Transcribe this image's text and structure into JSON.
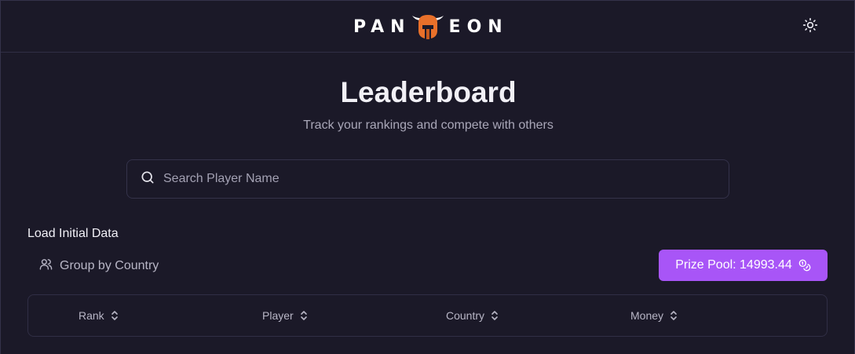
{
  "header": {
    "logo_left": "PAN",
    "logo_right": "EON",
    "theme_toggle_icon": "sun-icon"
  },
  "page": {
    "title": "Leaderboard",
    "subtitle": "Track your rankings and compete with others"
  },
  "search": {
    "placeholder": "Search Player Name",
    "value": "",
    "icon": "search-icon"
  },
  "controls": {
    "load_initial_data": "Load Initial Data",
    "group_by_country": "Group by Country",
    "group_icon": "users-icon",
    "prize_pool": "Prize Pool: 14993.44",
    "prize_icon": "coins-icon"
  },
  "table": {
    "columns": [
      "Rank",
      "Player",
      "Country",
      "Money"
    ],
    "sort_icon": "chevrons-up-down-icon",
    "rows": []
  },
  "colors": {
    "background": "#1b1928",
    "accent": "#a855f7",
    "logo_orange": "#e8702a",
    "border": "#302e45"
  }
}
